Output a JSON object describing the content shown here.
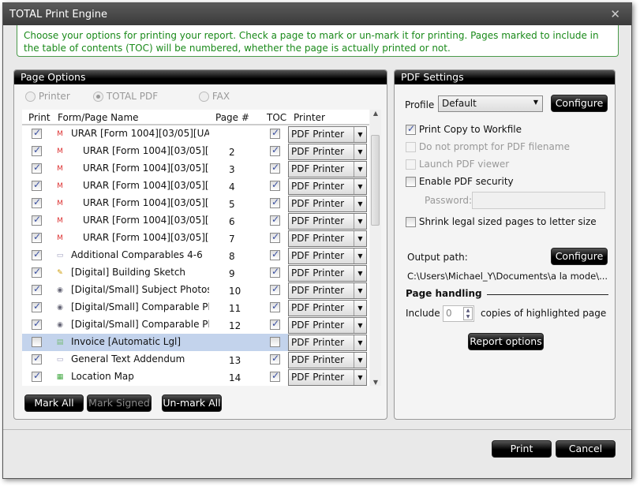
{
  "window": {
    "title": "TOTAL Print Engine",
    "close_icon": "close-icon"
  },
  "info": "Choose your options for printing your report.  Check a page to mark or un-mark it for printing.  Pages marked to include in the table of contents (TOC) will be numbered, whether the page is actually printed or not.",
  "page_options": {
    "title": "Page Options",
    "modes": [
      {
        "label": "Printer",
        "selected": false
      },
      {
        "label": "TOTAL PDF",
        "selected": true
      },
      {
        "label": "FAX",
        "selected": false
      }
    ],
    "columns": [
      "Print",
      "Form/Page Name",
      "Page #",
      "TOC",
      "Printer"
    ],
    "rows": [
      {
        "print": true,
        "icon": "form-m-icon",
        "name": "URAR [Form 1004][03/05][UAD",
        "indent": false,
        "page": "",
        "toc": true,
        "printer": "PDF Printer"
      },
      {
        "print": true,
        "icon": "form-m-icon",
        "name": "URAR [Form 1004][03/05][U/",
        "indent": true,
        "page": "2",
        "toc": true,
        "printer": "PDF Printer"
      },
      {
        "print": true,
        "icon": "form-m-icon",
        "name": "URAR [Form 1004][03/05][U/",
        "indent": true,
        "page": "3",
        "toc": true,
        "printer": "PDF Printer"
      },
      {
        "print": true,
        "icon": "form-m-icon",
        "name": "URAR [Form 1004][03/05][U/",
        "indent": true,
        "page": "4",
        "toc": true,
        "printer": "PDF Printer"
      },
      {
        "print": true,
        "icon": "form-m-icon",
        "name": "URAR [Form 1004][03/05][U/",
        "indent": true,
        "page": "5",
        "toc": true,
        "printer": "PDF Printer"
      },
      {
        "print": true,
        "icon": "form-m-icon",
        "name": "URAR [Form 1004][03/05][U/",
        "indent": true,
        "page": "6",
        "toc": true,
        "printer": "PDF Printer"
      },
      {
        "print": true,
        "icon": "form-m-icon",
        "name": "URAR [Form 1004][03/05][U/",
        "indent": true,
        "page": "7",
        "toc": true,
        "printer": "PDF Printer"
      },
      {
        "print": true,
        "icon": "page-icon",
        "name": "Additional Comparables 4-6",
        "indent": false,
        "page": "8",
        "toc": true,
        "printer": "PDF Printer"
      },
      {
        "print": true,
        "icon": "sketch-icon",
        "name": "[Digital] Building Sketch",
        "indent": false,
        "page": "9",
        "toc": true,
        "printer": "PDF Printer"
      },
      {
        "print": true,
        "icon": "camera-icon",
        "name": "[Digital/Small] Subject Photos",
        "indent": false,
        "page": "10",
        "toc": true,
        "printer": "PDF Printer"
      },
      {
        "print": true,
        "icon": "camera-icon",
        "name": "[Digital/Small] Comparable Phot",
        "indent": false,
        "page": "11",
        "toc": true,
        "printer": "PDF Printer"
      },
      {
        "print": true,
        "icon": "camera-icon",
        "name": "[Digital/Small] Comparable Phot",
        "indent": false,
        "page": "12",
        "toc": true,
        "printer": "PDF Printer"
      },
      {
        "print": false,
        "icon": "invoice-icon",
        "name": "Invoice [Automatic Lgl]",
        "indent": false,
        "page": "",
        "toc": false,
        "printer": "PDF Printer",
        "selected": true
      },
      {
        "print": true,
        "icon": "page-icon",
        "name": "General Text Addendum",
        "indent": false,
        "page": "13",
        "toc": true,
        "printer": "PDF Printer"
      },
      {
        "print": true,
        "icon": "map-icon",
        "name": "Location Map",
        "indent": false,
        "page": "14",
        "toc": true,
        "printer": "PDF Printer"
      }
    ],
    "buttons": {
      "mark_all": "Mark All",
      "mark_signed": "Mark Signed",
      "unmark_all": "Un-mark All"
    }
  },
  "pdf_settings": {
    "title": "PDF Settings",
    "profile_label": "Profile",
    "profile_value": "Default",
    "configure": "Configure",
    "options": [
      {
        "label": "Print Copy to Workfile",
        "checked": true,
        "enabled": true
      },
      {
        "label": "Do not prompt for PDF filename",
        "checked": false,
        "enabled": false
      },
      {
        "label": "Launch PDF viewer",
        "checked": false,
        "enabled": false
      },
      {
        "label": "Enable PDF security",
        "checked": false,
        "enabled": true
      }
    ],
    "password_label": "Password:",
    "password_value": "",
    "shrink": {
      "label": "Shrink legal sized pages to letter size",
      "checked": false
    },
    "output_path_label": "Output path:",
    "output_configure": "Configure",
    "output_path": "C:\\Users\\Michael_Y\\Documents\\a la mode\\...",
    "page_handling": "Page handling",
    "include_label": "Include",
    "copies": "0",
    "copies_label": "copies of highlighted page",
    "report_options": "Report options"
  },
  "footer": {
    "print": "Print",
    "cancel": "Cancel"
  }
}
